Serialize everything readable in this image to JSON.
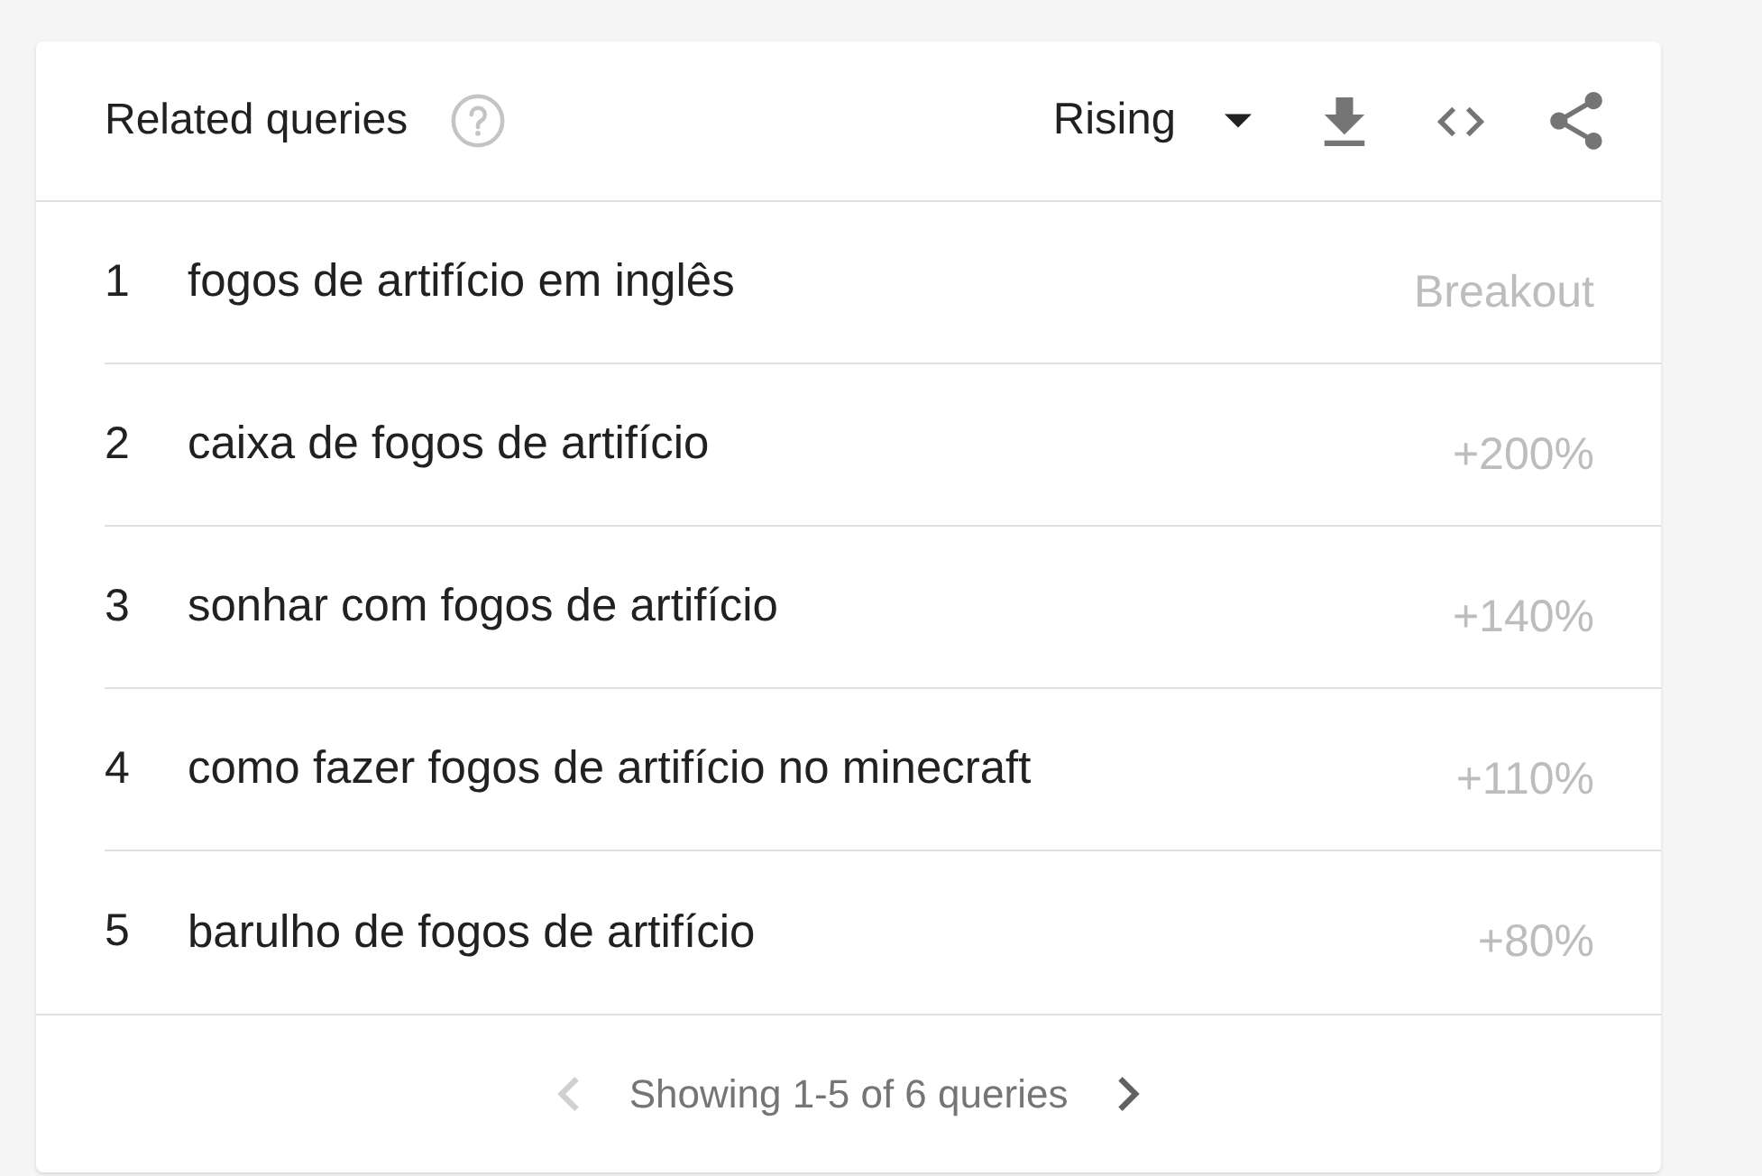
{
  "card": {
    "title": "Related queries",
    "filter": {
      "value": "Rising"
    }
  },
  "rows": [
    {
      "rank": "1",
      "query": "fogos de artifício em inglês",
      "value": "Breakout"
    },
    {
      "rank": "2",
      "query": "caixa de fogos de artifício",
      "value": "+200%"
    },
    {
      "rank": "3",
      "query": "sonhar com fogos de artifício",
      "value": "+140%"
    },
    {
      "rank": "4",
      "query": "como fazer fogos de artifício no minecraft",
      "value": "+110%"
    },
    {
      "rank": "5",
      "query": "barulho de fogos de artifício",
      "value": "+80%"
    }
  ],
  "pagination": {
    "text": "Showing 1-5 of 6 queries",
    "prev": {
      "disabled": true
    },
    "next": {
      "disabled": false
    }
  }
}
